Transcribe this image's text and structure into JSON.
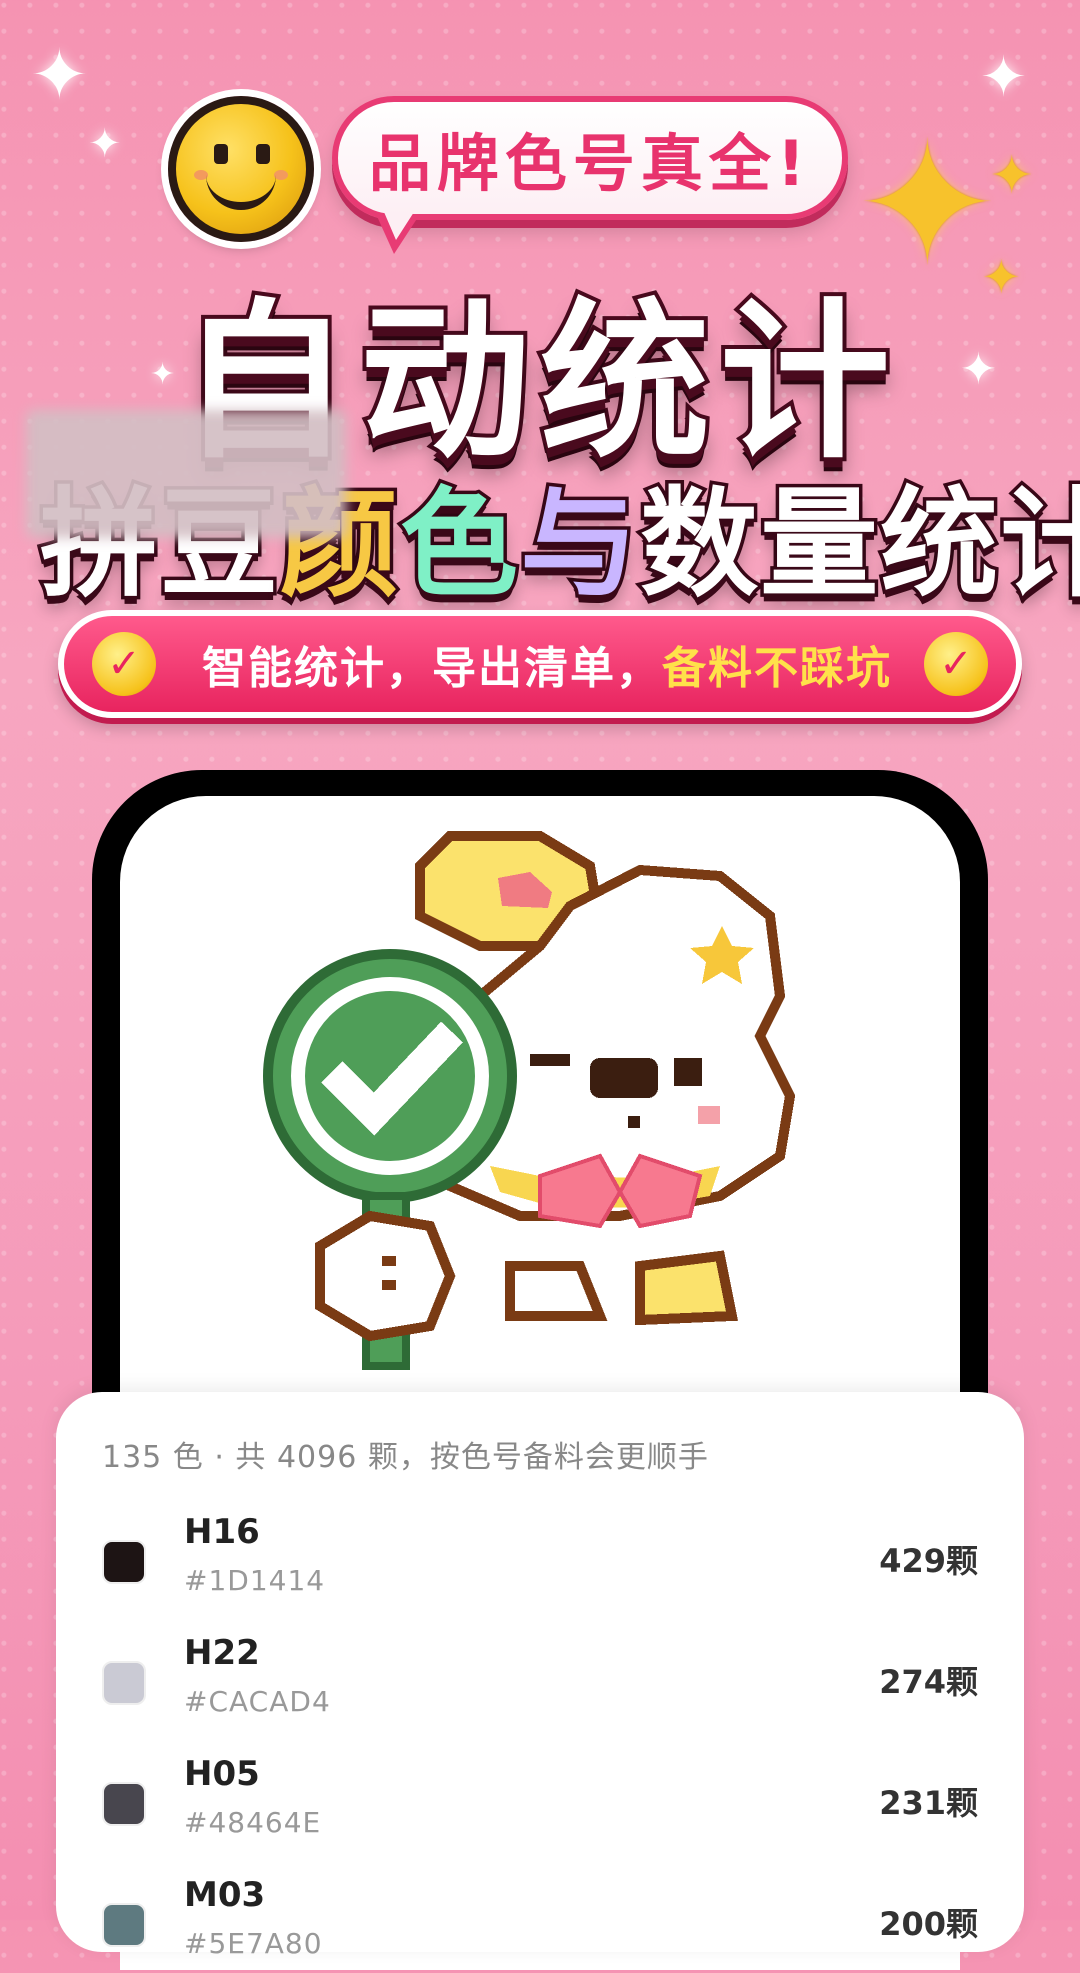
{
  "hero": {
    "bubble_text": "品牌色号真全!",
    "headline": "自动统计",
    "subhead_obscured": "拼豆",
    "subhead_parts": [
      "颜",
      "色",
      "与",
      "数量统计"
    ],
    "banner_left": "智能统计，导出清单，",
    "banner_highlight": "备料不踩坑"
  },
  "colors": {
    "accent": "#e8245f",
    "highlight": "#ffe14a"
  },
  "list": {
    "summary": "135 色 · 共 4096 颗，按色号备料会更顺手",
    "items": [
      {
        "code": "H16",
        "hex": "#1D1414",
        "count": "429颗"
      },
      {
        "code": "H22",
        "hex": "#CACAD4",
        "count": "274颗"
      },
      {
        "code": "H05",
        "hex": "#48464E",
        "count": "231颗"
      },
      {
        "code": "M03",
        "hex": "#5E7A80",
        "count": "200颗"
      }
    ]
  },
  "icons": [
    "sparkle-icon",
    "smiley-icon",
    "gold-star-icon",
    "check-icon",
    "pixel-bear-illustration"
  ]
}
